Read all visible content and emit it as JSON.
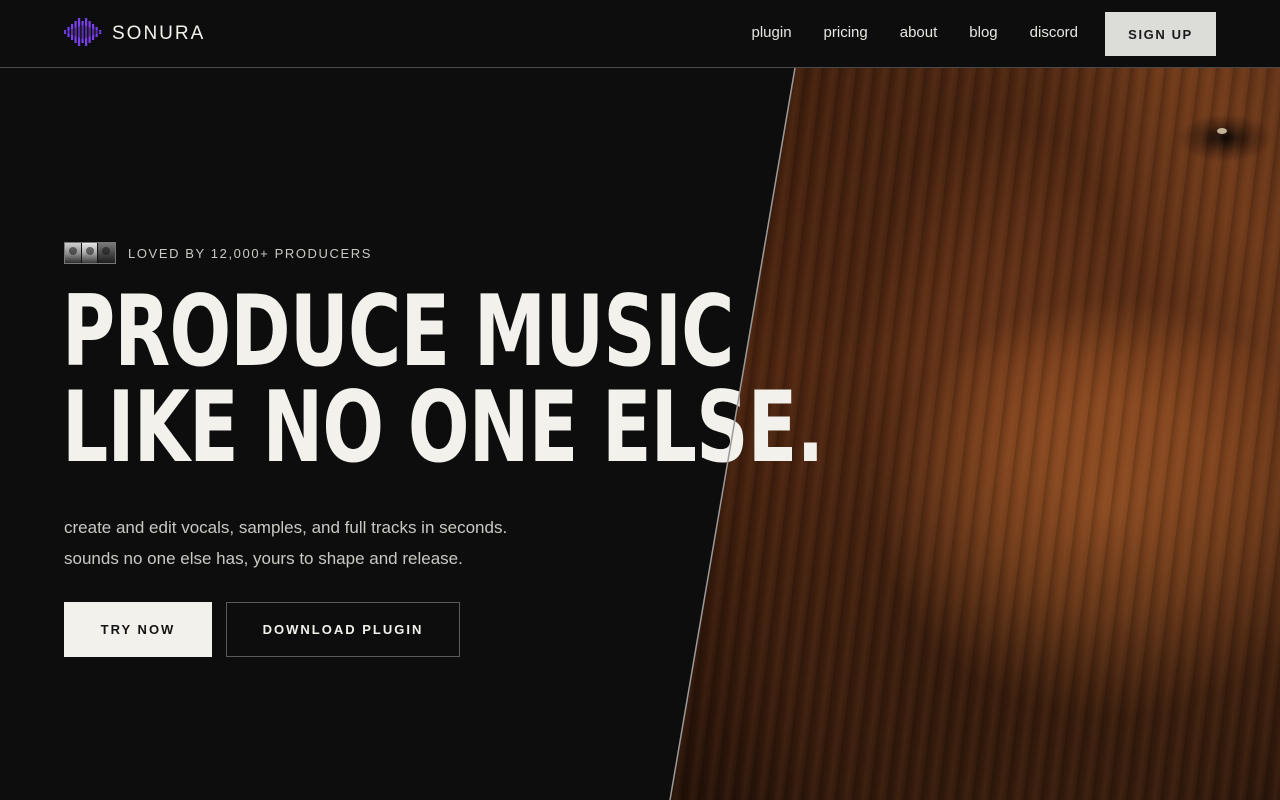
{
  "brand": {
    "name": "SONURA",
    "logo_icon": "waveform-icon",
    "accent_color": "#7b3ff2"
  },
  "nav": {
    "items": [
      {
        "label": "plugin"
      },
      {
        "label": "pricing"
      },
      {
        "label": "about"
      },
      {
        "label": "blog"
      },
      {
        "label": "discord"
      }
    ],
    "signup_label": "SIGN UP"
  },
  "hero": {
    "social_proof": "LOVED BY 12,000+ PRODUCERS",
    "headline_line1": "PRODUCE MUSIC",
    "headline_line2": "LIKE NO ONE ELSE.",
    "subtext_line1": "create and edit vocals, samples, and full tracks in seconds.",
    "subtext_line2": "sounds no one else has, yours to shape and release.",
    "primary_cta": "TRY NOW",
    "secondary_cta": "DOWNLOAD PLUGIN"
  },
  "colors": {
    "background": "#0d0d0e",
    "text": "#f2f1ec",
    "muted_text": "#c9c8c3"
  }
}
